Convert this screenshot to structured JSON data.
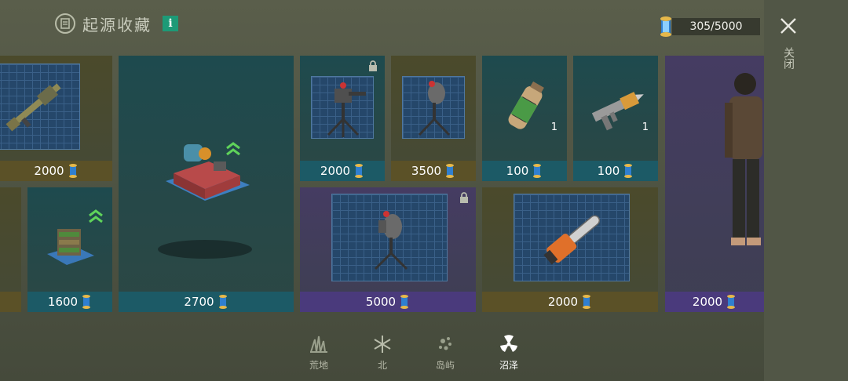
{
  "header": {
    "title": "起源收藏",
    "info_label": "i"
  },
  "currency": {
    "value": "305/5000",
    "icon": "scroll-token-icon"
  },
  "close": {
    "label": "关闭"
  },
  "cards": [
    {
      "id": "rifle",
      "price": "2000",
      "theme": "olive",
      "icon": "rifle-blueprint-icon"
    },
    {
      "id": "shelf",
      "price": "1600",
      "theme": "teal",
      "icon": "shelf-blueprint-icon"
    },
    {
      "id": "workbench",
      "price": "2700",
      "theme": "teal",
      "icon": "workbench-icon"
    },
    {
      "id": "turret-1",
      "price": "2000",
      "theme": "teal",
      "icon": "turret-blueprint-icon",
      "locked": true
    },
    {
      "id": "turret-2",
      "price": "3500",
      "theme": "olive",
      "icon": "turret-blueprint-icon"
    },
    {
      "id": "canister",
      "price": "100",
      "theme": "teal",
      "icon": "gas-canister-icon",
      "qty": "1"
    },
    {
      "id": "syringe-gun",
      "price": "100",
      "theme": "teal",
      "icon": "syringe-gun-icon",
      "qty": "1"
    },
    {
      "id": "heavy-turret",
      "price": "5000",
      "theme": "purple",
      "icon": "heavy-turret-blueprint-icon",
      "locked": true
    },
    {
      "id": "chainsaw",
      "price": "2000",
      "theme": "olive",
      "icon": "chainsaw-blueprint-icon"
    },
    {
      "id": "outfit",
      "price": "2000",
      "theme": "purple",
      "icon": "character-outfit-icon"
    }
  ],
  "tabs": [
    {
      "label": "荒地",
      "icon": "grass-icon"
    },
    {
      "label": "北",
      "icon": "snowflake-icon"
    },
    {
      "label": "岛屿",
      "icon": "island-icon"
    },
    {
      "label": "沼泽",
      "icon": "radiation-icon",
      "active": true
    }
  ],
  "colors": {
    "teal_price": "#1c5a66",
    "olive_price": "#5b5127",
    "purple_price": "#4a3a7c",
    "info": "#1d9a77"
  }
}
